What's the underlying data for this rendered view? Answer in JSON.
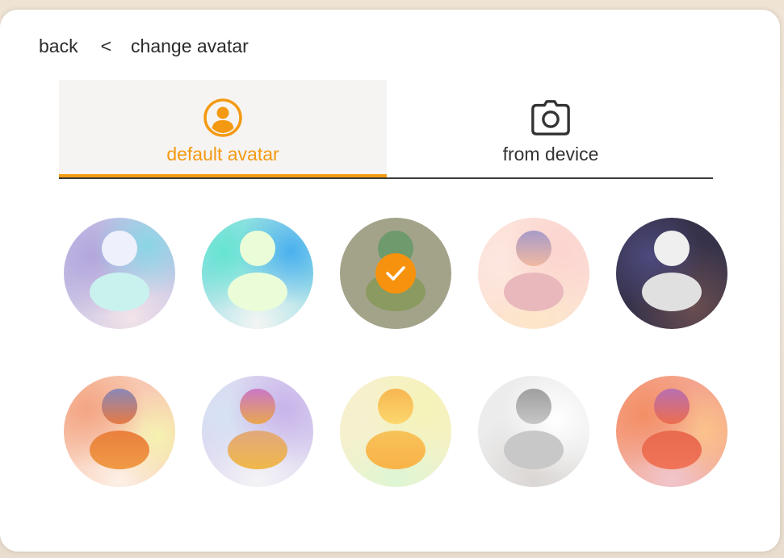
{
  "header": {
    "back_label": "back",
    "separator": "<",
    "title": "change avatar"
  },
  "tabs": [
    {
      "label": "default avatar",
      "icon": "user-circle-icon",
      "active": true
    },
    {
      "label": "from device",
      "icon": "camera-icon",
      "active": false
    }
  ],
  "colors": {
    "accent": "#f39a12",
    "text": "#2b2b2b",
    "tab_active_bg": "#f6f4f3"
  },
  "avatars": [
    {
      "id": 1,
      "selected": false
    },
    {
      "id": 2,
      "selected": false
    },
    {
      "id": 3,
      "selected": true
    },
    {
      "id": 4,
      "selected": false
    },
    {
      "id": 5,
      "selected": false
    },
    {
      "id": 6,
      "selected": false
    },
    {
      "id": 7,
      "selected": false
    },
    {
      "id": 8,
      "selected": false
    },
    {
      "id": 9,
      "selected": false
    },
    {
      "id": 10,
      "selected": false
    }
  ]
}
